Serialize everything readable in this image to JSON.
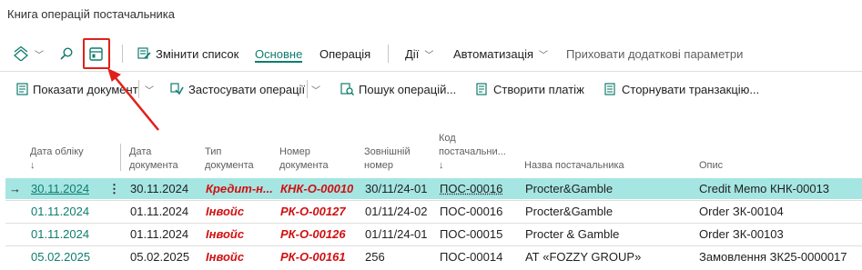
{
  "page": {
    "title": "Книга операцій постачальника"
  },
  "action_bar": {
    "change_list": "Змінити список",
    "main": "Основне",
    "operation": "Операція",
    "actions": "Дії",
    "automation": "Автоматизація",
    "hide_params": "Приховати додаткові параметри"
  },
  "tool_bar": {
    "show_document": "Показати документ",
    "apply_operations": "Застосувати операції",
    "search_operations": "Пошук операцій...",
    "create_payment": "Створити платіж",
    "reverse_transaction": "Сторнувати транзакцію..."
  },
  "table": {
    "headers": {
      "posting_date": [
        "Дата обліку",
        "↓"
      ],
      "document_date": [
        "Дата",
        "документа"
      ],
      "document_type": [
        "Тип",
        "документа"
      ],
      "document_no": [
        "Номер",
        "документа"
      ],
      "external_no": [
        "Зовнішній",
        "номер"
      ],
      "vendor_code": [
        "Код",
        "постачальни...",
        "↓"
      ],
      "vendor_name": "Назва постачальника",
      "description": "Опис"
    },
    "rows": [
      {
        "posting_date": "30.11.2024",
        "document_date": "30.11.2024",
        "document_type": "Кредит-н...",
        "document_no": "КНК-О-00010",
        "external_no": "30/11/24-01",
        "vendor_code": "ПОС-00016",
        "vendor_name": "Procter&Gamble",
        "description": "Credit Memo КНК-00013"
      },
      {
        "posting_date": "01.11.2024",
        "document_date": "01.11.2024",
        "document_type": "Інвойс",
        "document_no": "РК-О-00127",
        "external_no": "01/11/24-02",
        "vendor_code": "ПОС-00016",
        "vendor_name": "Procter&Gamble",
        "description": "Order ЗК-00104"
      },
      {
        "posting_date": "01.11.2024",
        "document_date": "01.11.2024",
        "document_type": "Інвойс",
        "document_no": "РК-О-00126",
        "external_no": "01/11/24-01",
        "vendor_code": "ПОС-00015",
        "vendor_name": "Procter & Gamble",
        "description": "Order ЗК-00103"
      },
      {
        "posting_date": "05.02.2025",
        "document_date": "05.02.2025",
        "document_type": "Інвойс",
        "document_no": "РК-О-00161",
        "external_no": "256",
        "vendor_code": "ПОС-00014",
        "vendor_name": "АТ «FOZZY GROUP»",
        "description": "Замовлення ЗК25-0000017"
      }
    ]
  },
  "colors": {
    "accent": "#0f7d6e",
    "selected_row": "#a5e6e2",
    "doc_red": "#d11010",
    "annotation_red": "#e0201b"
  }
}
